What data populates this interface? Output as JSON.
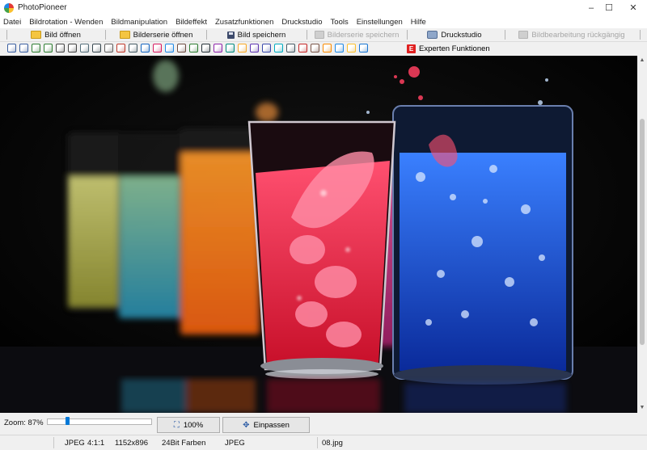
{
  "app": {
    "title": "PhotoPioneer"
  },
  "window_controls": {
    "minimize": "–",
    "maximize": "☐",
    "close": "✕"
  },
  "menu": [
    "Datei",
    "Bildrotation - Wenden",
    "Bildmanipulation",
    "Bildeffekt",
    "Zusatzfunktionen",
    "Druckstudio",
    "Tools",
    "Einstellungen",
    "Hilfe"
  ],
  "toolbar": {
    "open_image": "Bild öffnen",
    "open_series": "Bilderserie öffnen",
    "save_image": "Bild speichern",
    "save_series": "Bilderserie speichern",
    "print_studio": "Druckstudio",
    "undo_edit": "Bildbearbeitung rückgängig"
  },
  "toolbar2": {
    "expert_icon_letter": "E",
    "expert_functions": "Experten Funktionen",
    "icons": [
      {
        "name": "crop-icon",
        "color": "#3b5fa0"
      },
      {
        "name": "resize-icon",
        "color": "#3b5fa0"
      },
      {
        "name": "rotate-left-icon",
        "color": "#2e7d32"
      },
      {
        "name": "rotate-right-icon",
        "color": "#2e7d32"
      },
      {
        "name": "flip-icon",
        "color": "#444444"
      },
      {
        "name": "mirror-icon",
        "color": "#444444"
      },
      {
        "name": "perspective-icon",
        "color": "#546e7a"
      },
      {
        "name": "scissors-icon",
        "color": "#37474f"
      },
      {
        "name": "selection-icon",
        "color": "#616161"
      },
      {
        "name": "brush-icon",
        "color": "#c0392b"
      },
      {
        "name": "levels-icon",
        "color": "#455a64"
      },
      {
        "name": "histogram-icon",
        "color": "#1565c0"
      },
      {
        "name": "palette-icon",
        "color": "#d81b60"
      },
      {
        "name": "grid-icon",
        "color": "#1e88e5"
      },
      {
        "name": "frame-icon",
        "color": "#6d4c41"
      },
      {
        "name": "landscape-icon",
        "color": "#2e7d32"
      },
      {
        "name": "text-icon",
        "color": "#263238"
      },
      {
        "name": "magic-wand-icon",
        "color": "#8e24aa"
      },
      {
        "name": "image-adjust-icon",
        "color": "#00897b"
      },
      {
        "name": "pencil-icon",
        "color": "#f9a825"
      },
      {
        "name": "collage-icon",
        "color": "#5e35b1"
      },
      {
        "name": "gallery-icon",
        "color": "#3949ab"
      },
      {
        "name": "filter-icon",
        "color": "#00acc1"
      },
      {
        "name": "border-icon",
        "color": "#455a64"
      },
      {
        "name": "red-eye-icon",
        "color": "#c62828"
      },
      {
        "name": "layers-icon",
        "color": "#795548"
      },
      {
        "name": "color-picker-icon",
        "color": "#fb8c00"
      },
      {
        "name": "globe-icon",
        "color": "#1e88e5"
      },
      {
        "name": "star-icon",
        "color": "#fbc02d"
      },
      {
        "name": "info-icon",
        "color": "#1976d2"
      }
    ]
  },
  "zoom": {
    "label": "Zoom: 87%",
    "level": 0.87,
    "btn_100": "100%",
    "btn_fit": "Einpassen"
  },
  "status": {
    "format": "JPEG",
    "aspect": "4:1:1",
    "dimensions": "1152x896",
    "colors": "24Bit Farben",
    "type": "JPEG",
    "filename": "08.jpg"
  }
}
